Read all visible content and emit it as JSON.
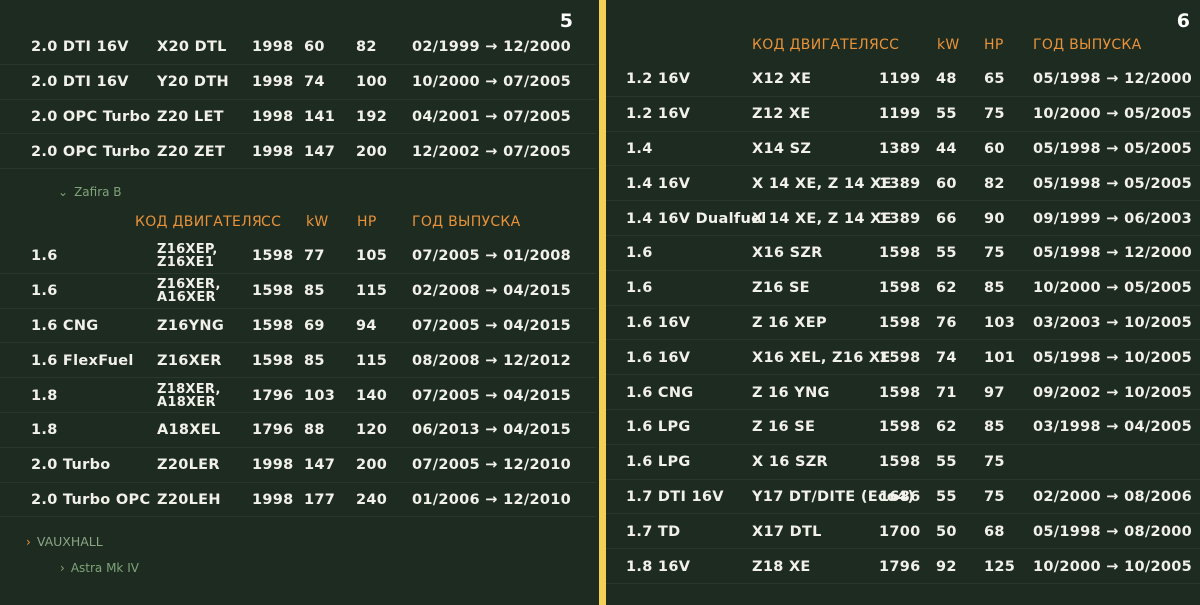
{
  "left": {
    "page_number": "5",
    "rows_top": [
      [
        "2.0 DTI 16V",
        "X20 DTL",
        "1998",
        "60",
        "82",
        "02/1999 → 12/2000"
      ],
      [
        "2.0 DTI 16V",
        "Y20 DTH",
        "1998",
        "74",
        "100",
        "10/2000 → 07/2005"
      ],
      [
        "2.0 OPC Turbo",
        "Z20 LET",
        "1998",
        "141",
        "192",
        "04/2001 → 07/2005"
      ],
      [
        "2.0 OPC Turbo",
        "Z20 ZET",
        "1998",
        "147",
        "200",
        "12/2002 → 07/2005"
      ]
    ],
    "zafira_label": "Zafira B",
    "zafira_arrow": "⌄",
    "header": {
      "engine_code": "КОД ДВИГАТЕЛЯ",
      "cc": "CC",
      "kw": "kW",
      "hp": "HP",
      "years": "ГОД ВЫПУСКА"
    },
    "rows_bottom": [
      [
        "1.6",
        "Z16XEP,\nZ16XE1",
        "1598",
        "77",
        "105",
        "07/2005 → 01/2008"
      ],
      [
        "1.6",
        "Z16XER,\nA16XER",
        "1598",
        "85",
        "115",
        "02/2008 → 04/2015"
      ],
      [
        "1.6 CNG",
        "Z16YNG",
        "1598",
        "69",
        "94",
        "07/2005 → 04/2015"
      ],
      [
        "1.6 FlexFuel",
        "Z16XER",
        "1598",
        "85",
        "115",
        "08/2008 → 12/2012"
      ],
      [
        "1.8",
        "Z18XER,\nA18XER",
        "1796",
        "103",
        "140",
        "07/2005 → 04/2015"
      ],
      [
        "1.8",
        "A18XEL",
        "1796",
        "88",
        "120",
        "06/2013 → 04/2015"
      ],
      [
        "2.0 Turbo",
        "Z20LER",
        "1998",
        "147",
        "200",
        "07/2005 → 12/2010"
      ],
      [
        "2.0 Turbo OPC",
        "Z20LEH",
        "1998",
        "177",
        "240",
        "01/2006 → 12/2010"
      ]
    ],
    "vauxhall_label": "VAUXHALL",
    "vauxhall_arrow": "›",
    "astra_label": "Astra Mk IV",
    "astra_arrow": "›"
  },
  "right": {
    "page_number": "6",
    "header": {
      "engine_code": "КОД ДВИГАТЕЛЯ",
      "cc": "CC",
      "kw": "kW",
      "hp": "HP",
      "years": "ГОД ВЫПУСКА"
    },
    "rows": [
      [
        "1.2 16V",
        "X12 XE",
        "1199",
        "48",
        "65",
        "05/1998 → 12/2000"
      ],
      [
        "1.2 16V",
        "Z12 XE",
        "1199",
        "55",
        "75",
        "10/2000 → 05/2005"
      ],
      [
        "1.4",
        "X14 SZ",
        "1389",
        "44",
        "60",
        "05/1998 → 05/2005"
      ],
      [
        "1.4 16V",
        "X 14 XE, Z 14 XE",
        "1389",
        "60",
        "82",
        "05/1998 → 05/2005"
      ],
      [
        "1.4 16V Dualfuel",
        "X 14 XE, Z 14 XE",
        "1389",
        "66",
        "90",
        "09/1999 → 06/2003"
      ],
      [
        "1.6",
        "X16 SZR",
        "1598",
        "55",
        "75",
        "05/1998 → 12/2000"
      ],
      [
        "1.6",
        "Z16 SE",
        "1598",
        "62",
        "85",
        "10/2000 → 05/2005"
      ],
      [
        "1.6 16V",
        "Z 16 XEP",
        "1598",
        "76",
        "103",
        "03/2003 → 10/2005"
      ],
      [
        "1.6 16V",
        "X16 XEL, Z16 XE",
        "1598",
        "74",
        "101",
        "05/1998 → 10/2005"
      ],
      [
        "1.6 CNG",
        "Z 16 YNG",
        "1598",
        "71",
        "97",
        "09/2002 → 10/2005"
      ],
      [
        "1.6 LPG",
        "Z 16 SE",
        "1598",
        "62",
        "85",
        "03/1998 → 04/2005"
      ],
      [
        "1.6 LPG",
        "X 16 SZR",
        "1598",
        "55",
        "75",
        ""
      ],
      [
        "1.7 DTI 16V",
        "Y17 DT/DITE (Eco4)",
        "1686",
        "55",
        "75",
        "02/2000 → 08/2006"
      ],
      [
        "1.7 TD",
        "X17 DTL",
        "1700",
        "50",
        "68",
        "05/1998 → 08/2000"
      ],
      [
        "1.8 16V",
        "Z18 XE",
        "1796",
        "92",
        "125",
        "10/2000 → 10/2005"
      ]
    ]
  }
}
